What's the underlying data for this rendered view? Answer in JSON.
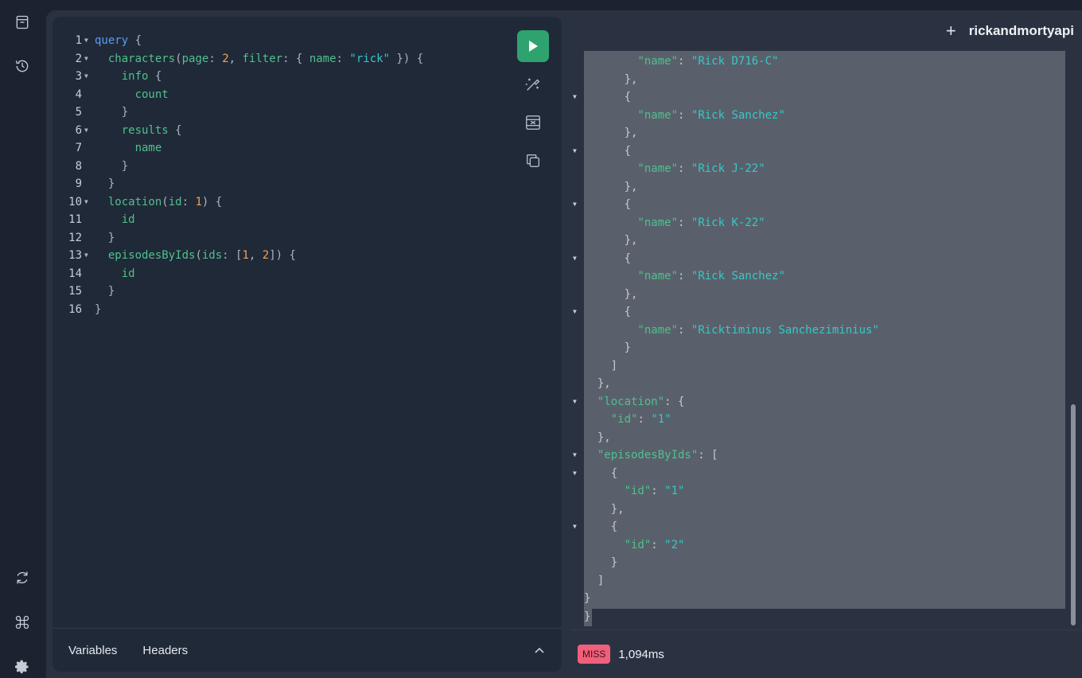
{
  "app": {
    "api_name": "rickandmortyapi"
  },
  "sidebar": {
    "top": [
      {
        "name": "docs-icon"
      },
      {
        "name": "history-icon"
      }
    ],
    "bottom": [
      {
        "name": "refetch-schema-icon"
      },
      {
        "name": "shortcuts-icon"
      },
      {
        "name": "settings-icon"
      }
    ]
  },
  "editor": {
    "lines": [
      {
        "n": "1",
        "fold": true,
        "html": "<span class=\"kw\">query</span> <span class=\"pun\">{</span>"
      },
      {
        "n": "2",
        "fold": true,
        "html": "  <span class=\"fld\">characters</span><span class=\"pun\">(</span><span class=\"attr\">page</span><span class=\"pun\">:</span> <span class=\"num\">2</span><span class=\"pun\">,</span> <span class=\"attr\">filter</span><span class=\"pun\">: {</span> <span class=\"attr\">name</span><span class=\"pun\">:</span> <span class=\"str\">\"rick\"</span> <span class=\"pun\">}) {</span>"
      },
      {
        "n": "3",
        "fold": true,
        "html": "    <span class=\"fld\">info</span> <span class=\"pun\">{</span>"
      },
      {
        "n": "4",
        "fold": false,
        "html": "      <span class=\"fld\">count</span>"
      },
      {
        "n": "5",
        "fold": false,
        "html": "    <span class=\"pun\">}</span>"
      },
      {
        "n": "6",
        "fold": true,
        "html": "    <span class=\"fld\">results</span> <span class=\"pun\">{</span>"
      },
      {
        "n": "7",
        "fold": false,
        "html": "      <span class=\"fld\">name</span>"
      },
      {
        "n": "8",
        "fold": false,
        "html": "    <span class=\"pun\">}</span>"
      },
      {
        "n": "9",
        "fold": false,
        "html": "  <span class=\"pun\">}</span>"
      },
      {
        "n": "10",
        "fold": true,
        "html": "  <span class=\"fld\">location</span><span class=\"pun\">(</span><span class=\"attr\">id</span><span class=\"pun\">:</span> <span class=\"num\">1</span><span class=\"pun\">) {</span>"
      },
      {
        "n": "11",
        "fold": false,
        "html": "    <span class=\"fld\">id</span>"
      },
      {
        "n": "12",
        "fold": false,
        "html": "  <span class=\"pun\">}</span>"
      },
      {
        "n": "13",
        "fold": true,
        "html": "  <span class=\"fld\">episodesByIds</span><span class=\"pun\">(</span><span class=\"attr\">ids</span><span class=\"pun\">: [</span><span class=\"num\">1</span><span class=\"pun\">,</span> <span class=\"num\">2</span><span class=\"pun\">]) {</span>"
      },
      {
        "n": "14",
        "fold": false,
        "html": "    <span class=\"fld\">id</span>"
      },
      {
        "n": "15",
        "fold": false,
        "html": "  <span class=\"pun\">}</span>"
      },
      {
        "n": "16",
        "fold": false,
        "html": "<span class=\"pun\">}</span>"
      }
    ],
    "footer": {
      "variables_tab": "Variables",
      "headers_tab": "Headers"
    }
  },
  "toolbar": {
    "run": "execute-query-button",
    "prettify": "prettify-icon",
    "merge": "merge-fragments-icon",
    "copy": "copy-query-icon"
  },
  "result": {
    "lines": [
      {
        "fold": false,
        "html": "        <span class=\"key\">\"name\"</span><span class=\"pun\">:</span> <span class=\"val\">\"Rick D716-C\"</span>"
      },
      {
        "fold": false,
        "html": "      <span class=\"pun\">},</span>"
      },
      {
        "fold": true,
        "html": "      <span class=\"pun\">{</span>"
      },
      {
        "fold": false,
        "html": "        <span class=\"key\">\"name\"</span><span class=\"pun\">:</span> <span class=\"val\">\"Rick Sanchez\"</span>"
      },
      {
        "fold": false,
        "html": "      <span class=\"pun\">},</span>"
      },
      {
        "fold": true,
        "html": "      <span class=\"pun\">{</span>"
      },
      {
        "fold": false,
        "html": "        <span class=\"key\">\"name\"</span><span class=\"pun\">:</span> <span class=\"val\">\"Rick J-22\"</span>"
      },
      {
        "fold": false,
        "html": "      <span class=\"pun\">},</span>"
      },
      {
        "fold": true,
        "html": "      <span class=\"pun\">{</span>"
      },
      {
        "fold": false,
        "html": "        <span class=\"key\">\"name\"</span><span class=\"pun\">:</span> <span class=\"val\">\"Rick K-22\"</span>"
      },
      {
        "fold": false,
        "html": "      <span class=\"pun\">},</span>"
      },
      {
        "fold": true,
        "html": "      <span class=\"pun\">{</span>"
      },
      {
        "fold": false,
        "html": "        <span class=\"key\">\"name\"</span><span class=\"pun\">:</span> <span class=\"val\">\"Rick Sanchez\"</span>"
      },
      {
        "fold": false,
        "html": "      <span class=\"pun\">},</span>"
      },
      {
        "fold": true,
        "html": "      <span class=\"pun\">{</span>"
      },
      {
        "fold": false,
        "html": "        <span class=\"key\">\"name\"</span><span class=\"pun\">:</span> <span class=\"val\">\"Ricktiminus Sancheziminius\"</span>"
      },
      {
        "fold": false,
        "html": "      <span class=\"pun\">}</span>"
      },
      {
        "fold": false,
        "html": "    <span class=\"pun\">]</span>"
      },
      {
        "fold": false,
        "html": "  <span class=\"pun\">},</span>"
      },
      {
        "fold": true,
        "html": "  <span class=\"key\">\"location\"</span><span class=\"pun\">: {</span>"
      },
      {
        "fold": false,
        "html": "    <span class=\"key\">\"id\"</span><span class=\"pun\">:</span> <span class=\"val\">\"1\"</span>"
      },
      {
        "fold": false,
        "html": "  <span class=\"pun\">},</span>"
      },
      {
        "fold": true,
        "html": "  <span class=\"key\">\"episodesByIds\"</span><span class=\"pun\">: [</span>"
      },
      {
        "fold": true,
        "html": "    <span class=\"pun\">{</span>"
      },
      {
        "fold": false,
        "html": "      <span class=\"key\">\"id\"</span><span class=\"pun\">:</span> <span class=\"val\">\"1\"</span>"
      },
      {
        "fold": false,
        "html": "    <span class=\"pun\">},</span>"
      },
      {
        "fold": true,
        "html": "    <span class=\"pun\">{</span>"
      },
      {
        "fold": false,
        "html": "      <span class=\"key\">\"id\"</span><span class=\"pun\">:</span> <span class=\"val\">\"2\"</span>"
      },
      {
        "fold": false,
        "html": "    <span class=\"pun\">}</span>"
      },
      {
        "fold": false,
        "html": "  <span class=\"pun\">]</span>"
      },
      {
        "fold": false,
        "html": "<span class=\"pun\">}</span>"
      },
      {
        "fold": false,
        "html": "<span class=\"pun\">}</span>"
      }
    ]
  },
  "status": {
    "cache_badge": "MISS",
    "duration": "1,094ms"
  },
  "colors": {
    "run_button": "#2ea36f",
    "badge": "#f0607a",
    "selection": "#5a606b"
  }
}
